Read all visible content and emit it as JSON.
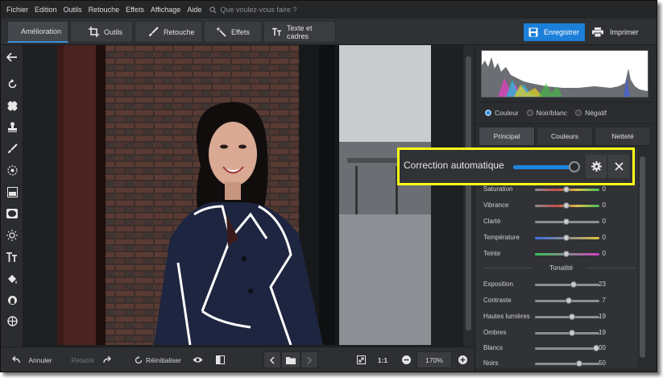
{
  "menu": [
    "Fichier",
    "Edition",
    "Outils",
    "Retouche",
    "Effets",
    "Affichage",
    "Aide"
  ],
  "search": {
    "placeholder": "Que voulez-vous faire ?"
  },
  "tabs": [
    {
      "label": "Amélioration",
      "icon": "sliders-icon"
    },
    {
      "label": "Outils",
      "icon": "crop-icon"
    },
    {
      "label": "Retouche",
      "icon": "brush-icon"
    },
    {
      "label": "Effets",
      "icon": "magic-wand-icon"
    },
    {
      "label": "Texte et cadres",
      "icon": "text-icon"
    }
  ],
  "actions": {
    "save": "Enregistrer",
    "print": "Imprimer"
  },
  "bottom": {
    "undo": "Annuler",
    "redo": "Rétablir",
    "reset": "Réinitialiser",
    "ratio": "1:1",
    "zoom": "170%"
  },
  "color_modes": [
    {
      "label": "Couleur",
      "selected": true
    },
    {
      "label": "Noir/blanc",
      "selected": false
    },
    {
      "label": "Négatif",
      "selected": false
    }
  ],
  "panel_tabs": [
    "Principal",
    "Couleurs",
    "Netteté"
  ],
  "callout": {
    "label": "Correction automatique"
  },
  "adjustments": [
    {
      "label": "Saturation",
      "value": "0"
    },
    {
      "label": "Vibrance",
      "value": "0"
    },
    {
      "label": "Clarté",
      "value": "0"
    },
    {
      "label": "Température",
      "value": "0"
    },
    {
      "label": "Teinte",
      "value": "0"
    }
  ],
  "tonality_title": "Tonalité",
  "tonality": [
    {
      "label": "Exposition",
      "value": "23"
    },
    {
      "label": "Contraste",
      "value": "7"
    },
    {
      "label": "Hautes lumières",
      "value": "19"
    },
    {
      "label": "Ombres",
      "value": "19"
    },
    {
      "label": "Blancs",
      "value": "100"
    },
    {
      "label": "Noirs",
      "value": "50"
    }
  ],
  "colors": {
    "accent": "#1c7fd8",
    "highlight_frame": "#ffff1a",
    "background": "#2b2d30"
  }
}
